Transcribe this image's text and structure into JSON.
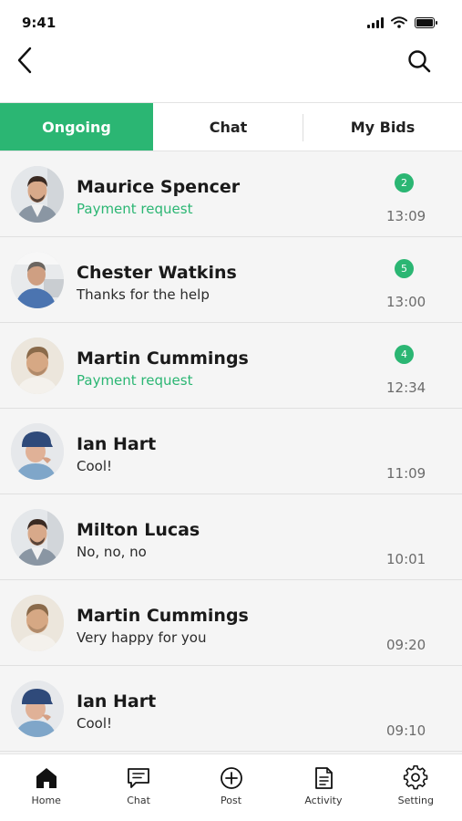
{
  "status_bar": {
    "time": "9:41"
  },
  "tabs": [
    {
      "label": "Ongoing",
      "active": true
    },
    {
      "label": "Chat",
      "active": false
    },
    {
      "label": "My Bids",
      "active": false
    }
  ],
  "colors": {
    "accent": "#2bb673",
    "row_bg": "#f5f5f5",
    "divider": "#e0e0e0"
  },
  "chats": [
    {
      "name": "Maurice Spencer",
      "message": "Payment request",
      "time": "13:09",
      "unread": "2",
      "avatar": "man-suit-avatar",
      "accent": true
    },
    {
      "name": "Chester Watkins",
      "message": "Thanks for the help",
      "time": "13:00",
      "unread": "5",
      "avatar": "man-blue-shirt-avatar",
      "accent": false
    },
    {
      "name": "Martin Cummings",
      "message": "Payment request",
      "time": "12:34",
      "unread": "4",
      "avatar": "man-stubble-avatar",
      "accent": true
    },
    {
      "name": "Ian Hart",
      "message": "Cool!",
      "time": "11:09",
      "unread": "",
      "avatar": "man-cap-avatar",
      "accent": false
    },
    {
      "name": "Milton Lucas",
      "message": "No, no, no",
      "time": "10:01",
      "unread": "",
      "avatar": "man-suit-avatar",
      "accent": false
    },
    {
      "name": "Martin Cummings",
      "message": "Very happy for you",
      "time": "09:20",
      "unread": "",
      "avatar": "man-stubble-avatar",
      "accent": false
    },
    {
      "name": "Ian Hart",
      "message": "Cool!",
      "time": "09:10",
      "unread": "",
      "avatar": "man-cap-avatar",
      "accent": false
    }
  ],
  "bottom_nav": [
    {
      "label": "Home",
      "icon": "home-icon"
    },
    {
      "label": "Chat",
      "icon": "chat-bubble-icon"
    },
    {
      "label": "Post",
      "icon": "plus-circle-icon"
    },
    {
      "label": "Activity",
      "icon": "document-icon"
    },
    {
      "label": "Setting",
      "icon": "gear-icon"
    }
  ]
}
